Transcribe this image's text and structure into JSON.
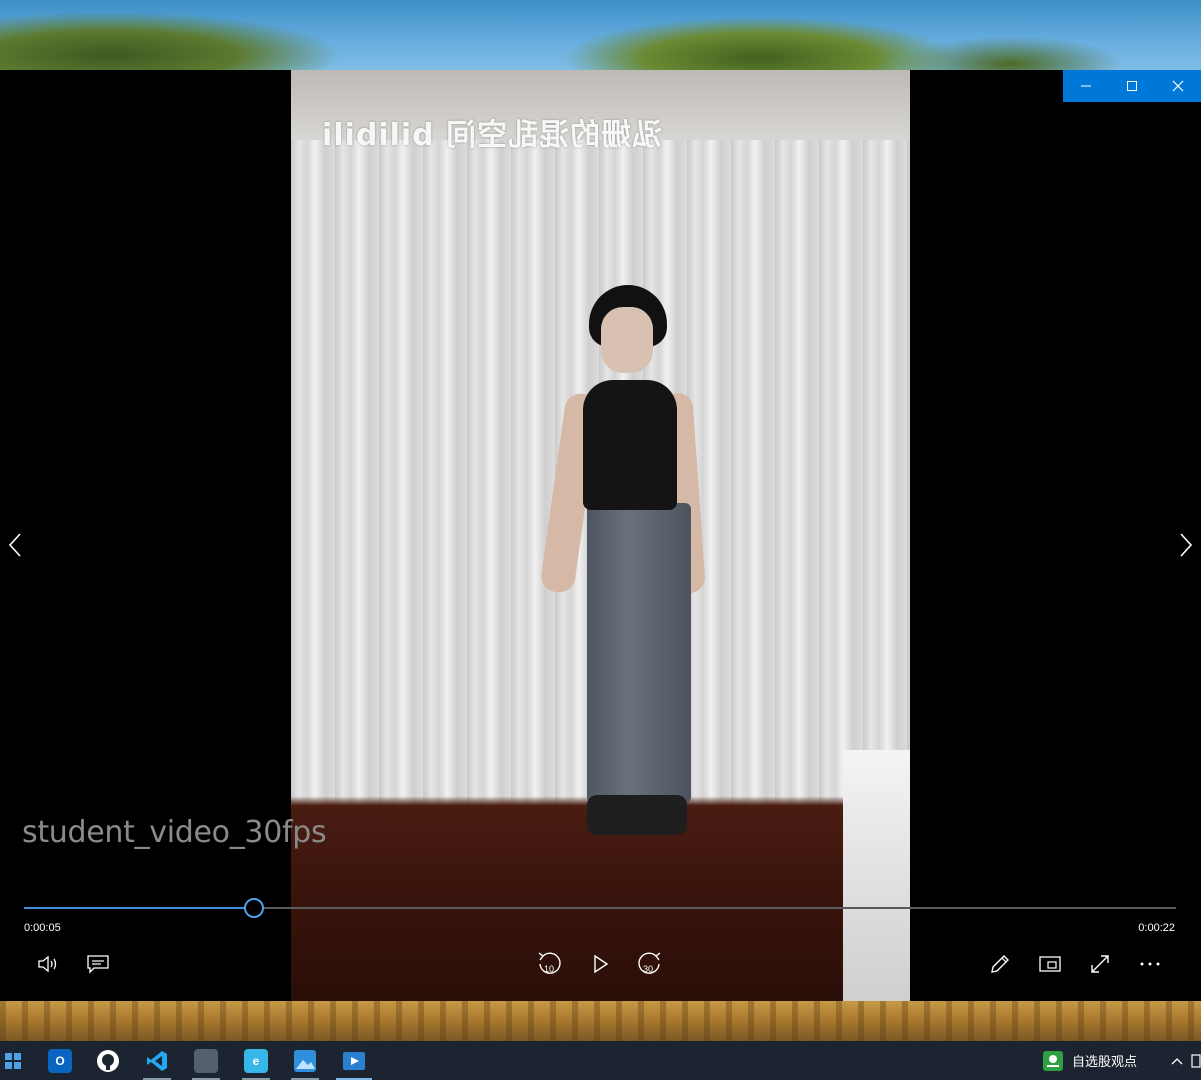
{
  "window": {
    "file_title": "student_video_30fps",
    "controls": {
      "minimize": "minimize",
      "maximize": "maximize",
      "close": "close"
    }
  },
  "video": {
    "watermark": "泓姗的混乱空间 bilibili"
  },
  "playback": {
    "elapsed": "0:00:05",
    "total": "0:00:22",
    "progress": 0.2
  },
  "controls": {
    "rewind_label": "10",
    "forward_label": "30"
  },
  "taskbar": {
    "apps": [
      "start-icon",
      "outlook-icon",
      "github-icon",
      "vscode-icon",
      "app-icon",
      "browser-icon",
      "photos-icon",
      "video-player-icon"
    ],
    "tray_widget_label": "自选股观点"
  },
  "colors": {
    "accent": "#0078d7",
    "seek_fill": "#3a8fd8"
  }
}
